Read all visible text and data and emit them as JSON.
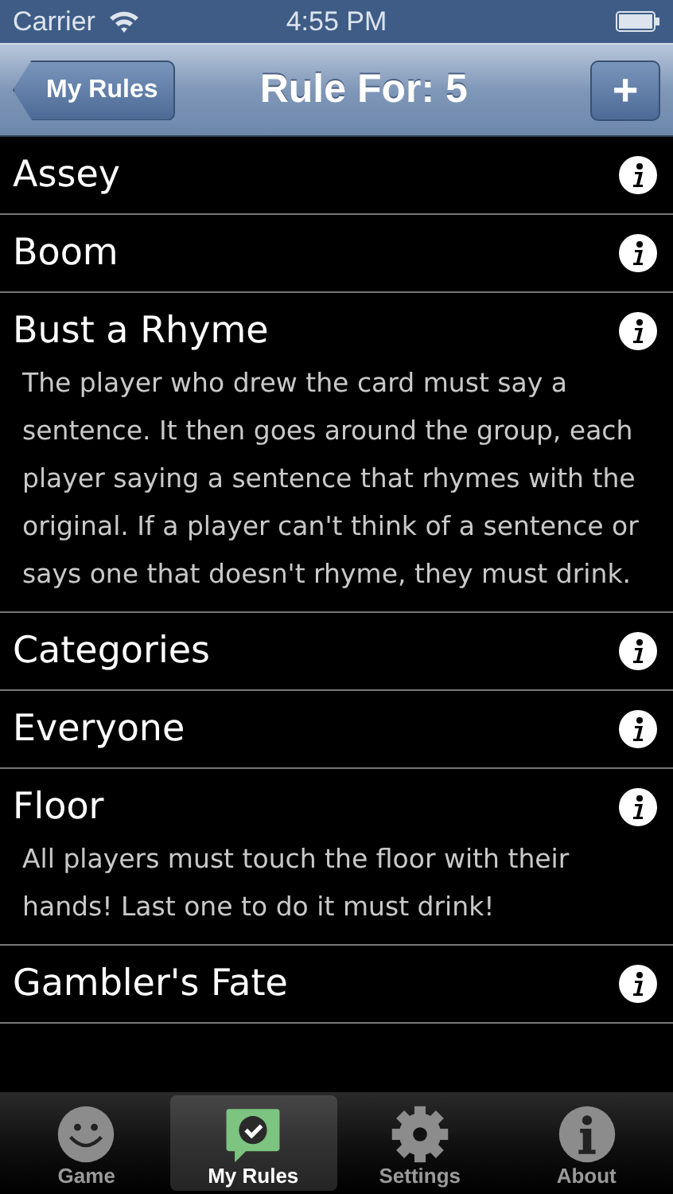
{
  "status_bar": {
    "carrier": "Carrier",
    "time": "4:55 PM"
  },
  "nav_bar": {
    "back": "My Rules",
    "title": "Rule For: 5",
    "add": "+"
  },
  "rules": [
    {
      "title": "Assey"
    },
    {
      "title": "Boom"
    },
    {
      "title": "Bust a Rhyme",
      "description": "The player who drew the card must say a sentence. It then goes around the group, each player saying a sentence that rhymes with the original. If a player can't think of a sentence or says one that doesn't rhyme, they must drink."
    },
    {
      "title": "Categories"
    },
    {
      "title": "Everyone"
    },
    {
      "title": "Floor",
      "description": "All players must touch the floor with their hands! Last one to do it must drink!"
    },
    {
      "title": "Gambler's Fate"
    }
  ],
  "tabs": [
    {
      "label": "Game",
      "selected": false
    },
    {
      "label": "My Rules",
      "selected": true
    },
    {
      "label": "Settings",
      "selected": false
    },
    {
      "label": "About",
      "selected": false
    }
  ]
}
